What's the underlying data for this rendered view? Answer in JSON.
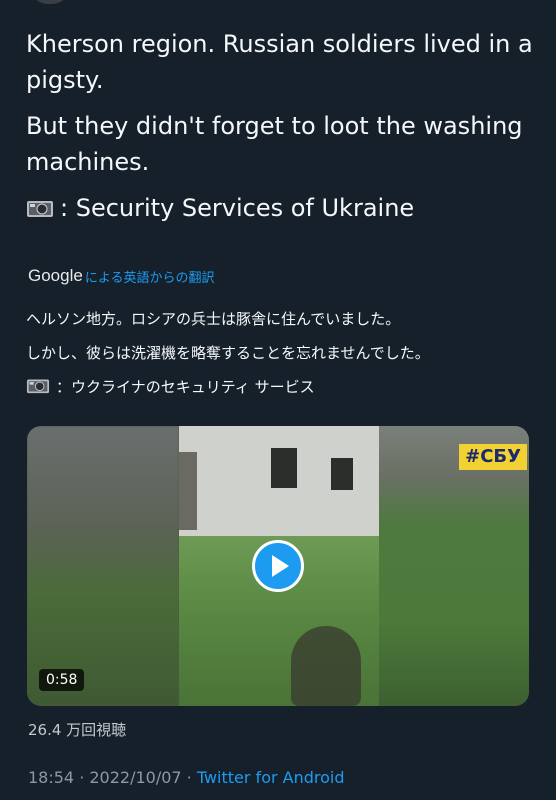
{
  "tweet": {
    "text_line1": "Kherson region. Russian soldiers lived in a pigsty.",
    "text_line2": "But they didn't forget to loot the washing machines.",
    "text_line3": ": Security Services of Ukraine"
  },
  "translation": {
    "google_label": "Google",
    "link_text": "による英語からの翻訳",
    "line1": "ヘルソン地方。ロシアの兵士は豚舎に住んでいました。",
    "line2": "しかし、彼らは洗濯機を略奪することを忘れませんでした。",
    "line3": "：ウクライナのセキュリティ サービス"
  },
  "video": {
    "badge": "#СБУ",
    "duration": "0:58"
  },
  "stats": {
    "views": "26.4 万回視聴"
  },
  "meta": {
    "time_date": "18:54 · 2022/10/07 · ",
    "app": "Twitter for Android"
  },
  "colors": {
    "background": "#15202b",
    "accent": "#1d9bf0",
    "badge_bg": "#f2d232"
  },
  "icons": [
    "video-camera-icon",
    "play-icon"
  ]
}
